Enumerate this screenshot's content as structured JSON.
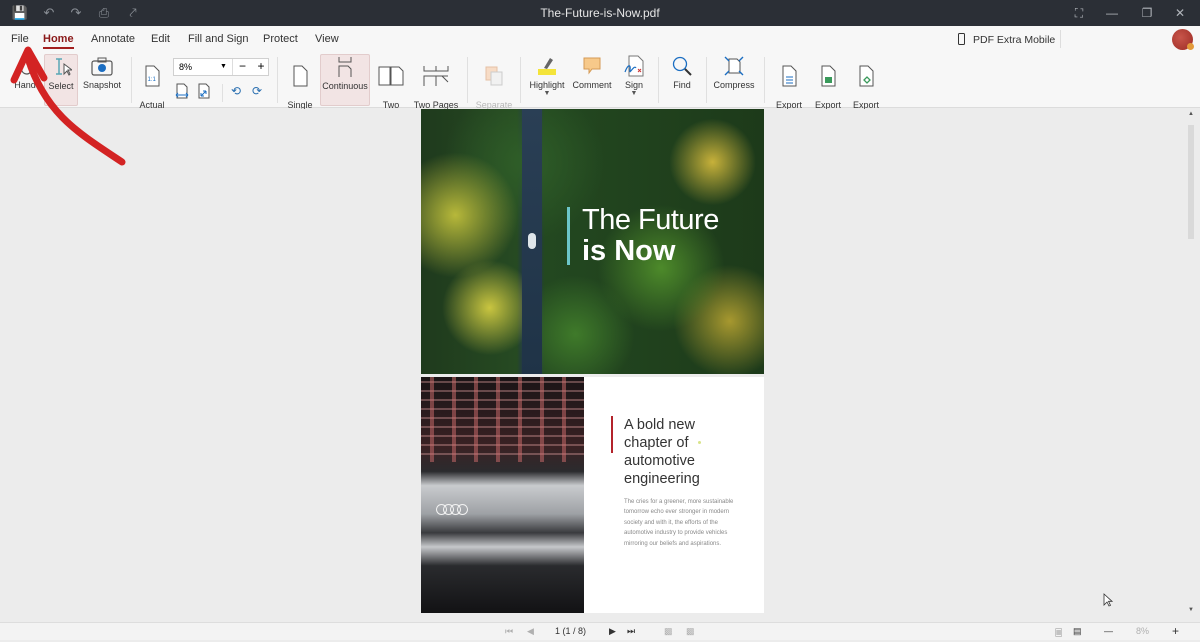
{
  "window": {
    "title": "The-Future-is-Now.pdf",
    "quick_access": [
      "save-icon",
      "undo-icon",
      "redo-icon",
      "print-icon",
      "share-icon"
    ],
    "controls": [
      "fullscreen-icon",
      "minimize-icon",
      "maximize-icon",
      "close-icon"
    ]
  },
  "menu": {
    "items": [
      {
        "label": "File"
      },
      {
        "label": "Home",
        "active": true
      },
      {
        "label": "Annotate"
      },
      {
        "label": "Edit"
      },
      {
        "label": "Fill and Sign"
      },
      {
        "label": "Protect"
      },
      {
        "label": "View"
      }
    ],
    "mobile_label": "PDF Extra Mobile"
  },
  "ribbon": {
    "hand_label": "Hand",
    "select_label": "Select",
    "snapshot_label": "Snapshot",
    "actual_size_label": "Actual\nSize",
    "zoom_value": "8%",
    "single_page_label": "Single\nPage",
    "continuous_label": "Continuous",
    "two_pages_label": "Two\nPages",
    "two_pages_continuous_label": "Two Pages\nContinuous",
    "separate_cover_label": "Separate\nCover",
    "highlight_label": "Highlight",
    "comment_label": "Comment",
    "sign_label": "Sign",
    "find_label": "Find",
    "compress_label": "Compress",
    "export_word_label": "Export\nto Word",
    "export_excel_label": "Export\nto Excel",
    "export_epub_label": "Export\nto ePub"
  },
  "document": {
    "page1": {
      "title_line1": "The Future",
      "title_line2": "is Now",
      "accent": "#6cc6c9"
    },
    "page2": {
      "heading": "A bold new chapter of automotive engineering",
      "body": "The cries for a greener, more sustainable tomorrow echo ever stronger in modern society and with it, the efforts of the automotive industry to provide vehicles mirroring our beliefs and aspirations.",
      "accent": "#b3232b"
    }
  },
  "status": {
    "page_indicator": "1 (1 / 8)",
    "zoom_value": "8%"
  },
  "colors": {
    "brand": "#a32020",
    "titlebar": "#2b2f36"
  }
}
